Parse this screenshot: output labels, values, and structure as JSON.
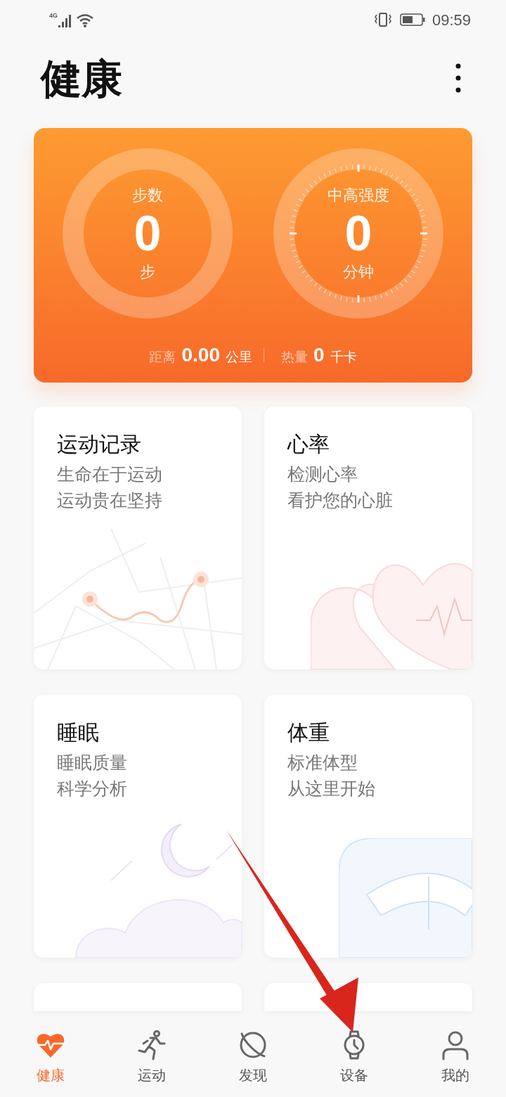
{
  "status_bar": {
    "network": "4G",
    "time": "09:59"
  },
  "header": {
    "title": "健康"
  },
  "summary": {
    "rings": [
      {
        "kind": "plain",
        "label": "步数",
        "value": "0",
        "unit": "步"
      },
      {
        "kind": "ticks",
        "label": "中高强度",
        "value": "0",
        "unit": "分钟"
      }
    ],
    "stats": [
      {
        "label": "距离",
        "value": "0.00",
        "unit": "公里"
      },
      {
        "label": "热量",
        "value": "0",
        "unit": "千卡"
      }
    ]
  },
  "cards": [
    {
      "kind": "route",
      "title": "运动记录",
      "lines": [
        "生命在于运动",
        "运动贵在坚持"
      ]
    },
    {
      "kind": "heart",
      "title": "心率",
      "lines": [
        "检测心率",
        "看护您的心脏"
      ]
    },
    {
      "kind": "sleep",
      "title": "睡眠",
      "lines": [
        "睡眠质量",
        "科学分析"
      ]
    },
    {
      "kind": "scale",
      "title": "体重",
      "lines": [
        "标准体型",
        "从这里开始"
      ]
    },
    {
      "kind": "blank"
    },
    {
      "kind": "blank"
    }
  ],
  "nav": [
    {
      "kind": "heart",
      "label": "健康",
      "selected": true
    },
    {
      "kind": "run",
      "label": "运动",
      "selected": false
    },
    {
      "kind": "planet",
      "label": "发现",
      "selected": false
    },
    {
      "kind": "watch",
      "label": "设备",
      "selected": false
    },
    {
      "kind": "person",
      "label": "我的",
      "selected": false
    }
  ]
}
